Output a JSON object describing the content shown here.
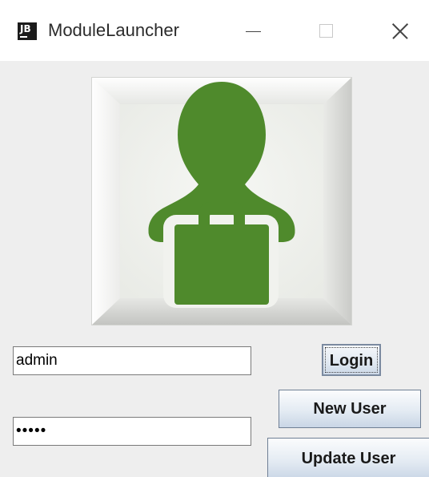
{
  "window": {
    "title": "ModuleLauncher",
    "icon_text": "JB",
    "controls": [
      "minimize-icon",
      "maximize-icon",
      "close-icon"
    ]
  },
  "logo": {
    "icon": "user-briefcase-icon",
    "color": "#4f8a2c"
  },
  "form": {
    "username_value": "admin",
    "password_value": "•••••"
  },
  "buttons": {
    "login_label": "Login",
    "new_user_label": "New User",
    "update_user_label": "Update User"
  }
}
